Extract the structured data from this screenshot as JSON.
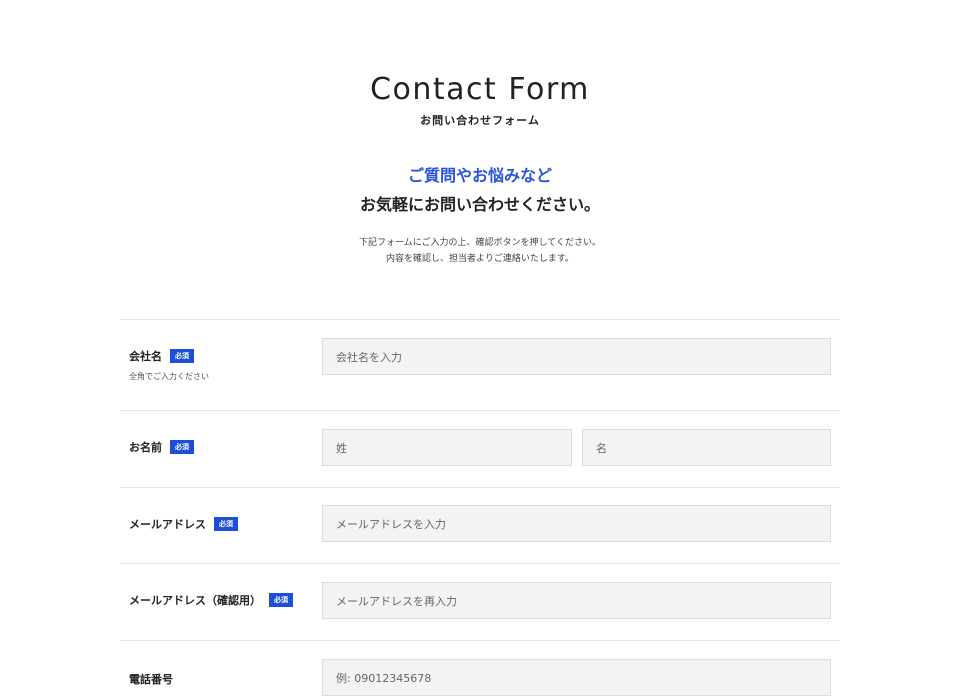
{
  "header": {
    "title": "Contact Form",
    "subtitle": "お問い合わせフォーム"
  },
  "lead": {
    "accent": "ご質問やお悩みなど",
    "main": "お気軽にお問い合わせください。",
    "accent_color": "#2b54d9"
  },
  "notes": [
    "下記フォームにご入力の上、確認ボタンを押してください。",
    "内容を確認し、担当者よりご連絡いたします。"
  ],
  "form": {
    "required_label": "必須",
    "badge_color": "#1d4ed8",
    "fields": {
      "company": {
        "label": "会社名",
        "hint": "全角でご入力ください",
        "placeholder": "会社名を入力"
      },
      "name": {
        "label": "お名前",
        "last_placeholder": "姓",
        "first_placeholder": "名"
      },
      "email": {
        "label": "メールアドレス",
        "placeholder": "メールアドレスを入力"
      },
      "email_confirm": {
        "label": "メールアドレス（確認用）",
        "placeholder": "メールアドレスを再入力"
      },
      "phone": {
        "label": "電話番号",
        "placeholder": "例: 09012345678"
      }
    }
  }
}
